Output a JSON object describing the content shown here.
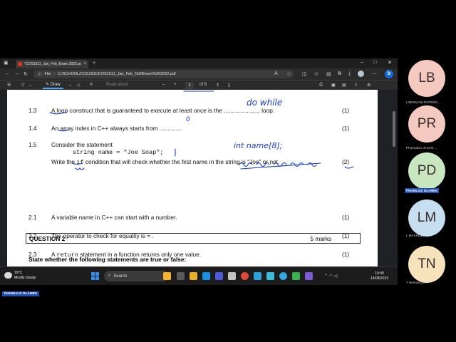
{
  "browser": {
    "tab_title": "*COS1511_Jan_Feb_Exam 2022.pdf",
    "address_prefix": "File",
    "address": "C:/SCHOOL/COS1511/COS1511_Jan_Feb_%20Exam%202022.pdf"
  },
  "pdf_toolbar": {
    "draw_label": "Draw",
    "read_aloud_label": "Read aloud",
    "page_current": "2",
    "page_total": "of 8"
  },
  "document": {
    "q13": {
      "num": "1.3",
      "text": "A loop construct that is guaranteed to execute at least once is the ...................... loop.",
      "mark": "(1)"
    },
    "q14": {
      "num": "1.4",
      "text": "An array index in C++ always starts from ..............",
      "mark": "(1)"
    },
    "q15": {
      "num": "1.5",
      "heading": "Consider the statement",
      "code": "string name = \"Joe Soap\";",
      "pre": "Write the ",
      "kw": "if",
      "post": " condition that will check whether the first name in the string is \"Joe\" or not.",
      "mark": "(2)"
    },
    "q2_header": {
      "title": "QUESTION 2",
      "marks": "5 marks"
    },
    "instruction": "State whether the following statements are true or false:",
    "q21": {
      "num": "2.1",
      "text": "A variable name in C++ can start with a number.",
      "mark": "(1)"
    },
    "q22": {
      "num": "2.2",
      "text": "The operator to check for equality is  =  .",
      "mark": "(1)"
    },
    "q23": {
      "num": "2.3",
      "pre": "A ",
      "kw": "return",
      "post": " statement in a function returns only one value.",
      "mark": "(1)"
    },
    "annotations": {
      "a1": "do while",
      "a2": "0",
      "a3": "int name[8];"
    }
  },
  "taskbar": {
    "temp": "19°C",
    "weather": "Mostly cloudy",
    "search_label": "Search",
    "time": "19:49",
    "date": "14/08/2023"
  },
  "participants": [
    {
      "initials": "LB",
      "name": "LINDELANI PATRICK...",
      "color": "#f4c9bf"
    },
    {
      "initials": "PR",
      "name": "Phumudzo Vincent ...",
      "color": "#f4c9bf"
    },
    {
      "initials": "PD",
      "name": "PHUMLILE DLAMINI",
      "color": "#c8e6c0"
    },
    {
      "initials": "LM",
      "name": "L MASHILE",
      "color": "#c5dff0"
    },
    {
      "initials": "TN",
      "name": "T Nemoarani",
      "color": "#f7e3bb"
    }
  ],
  "self_label": "PHUMLILE DLAMINI"
}
